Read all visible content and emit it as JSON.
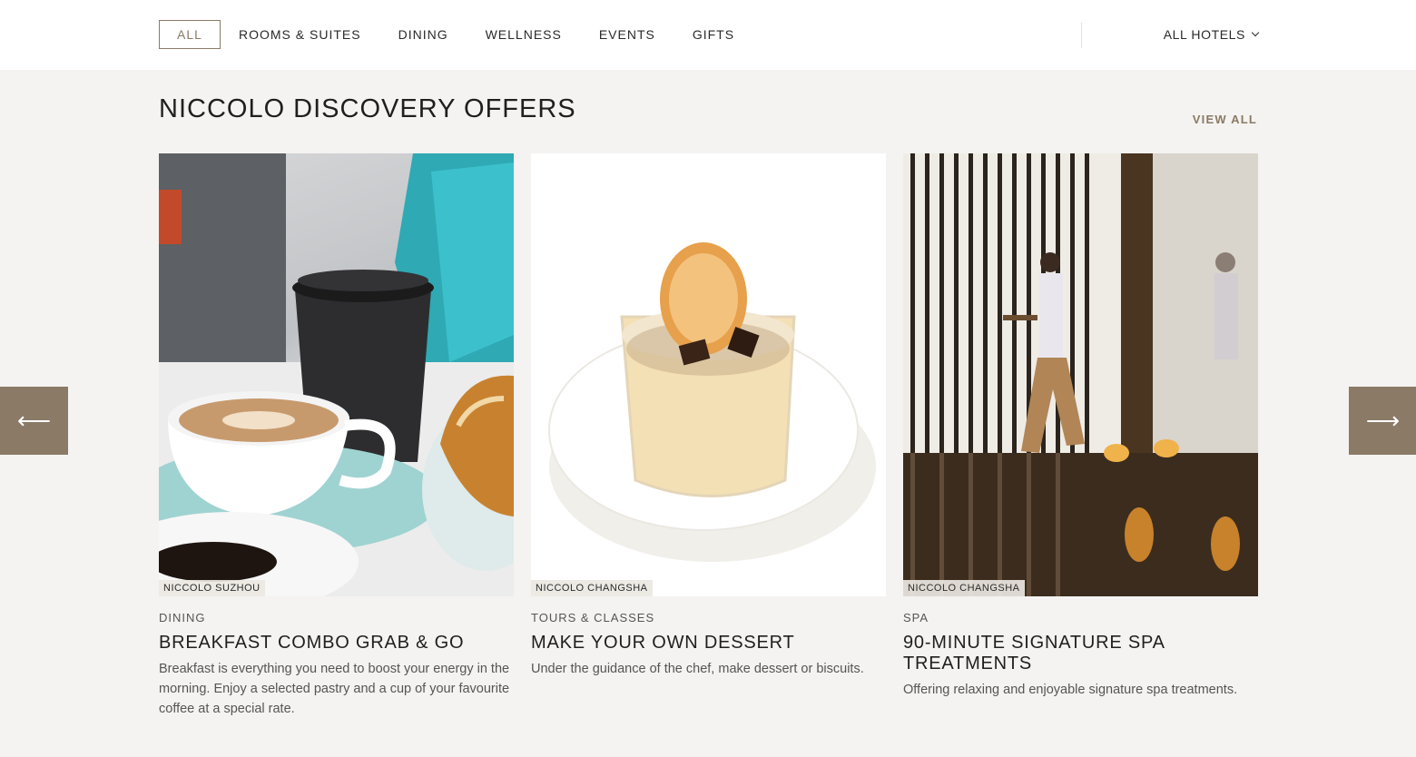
{
  "nav": {
    "tabs": [
      {
        "label": "ALL",
        "active": true
      },
      {
        "label": "ROOMS & SUITES",
        "active": false
      },
      {
        "label": "DINING",
        "active": false
      },
      {
        "label": "WELLNESS",
        "active": false
      },
      {
        "label": "EVENTS",
        "active": false
      },
      {
        "label": "GIFTS",
        "active": false
      }
    ],
    "hotel_filter": "ALL HOTELS",
    "hotel_filter_icon": "chevron-down-icon"
  },
  "section": {
    "title": "NICCOLO DISCOVERY OFFERS",
    "view_all": "VIEW ALL"
  },
  "carousel": {
    "prev_icon": "arrow-left-icon",
    "prev_glyph": "⟵",
    "next_icon": "arrow-right-icon",
    "next_glyph": "⟶"
  },
  "cards": [
    {
      "tag": "NICCOLO SUZHOU",
      "category": "DINING",
      "title": "BREAKFAST COMBO GRAB & GO",
      "description": "Breakfast is everything you need to boost your energy in the morning. Enjoy a selected pastry and a cup of your favourite coffee at a special rate."
    },
    {
      "tag": "NICCOLO CHANGSHA",
      "category": "TOURS & CLASSES",
      "title": "MAKE YOUR OWN DESSERT",
      "description": "Under the guidance of the chef, make dessert or biscuits."
    },
    {
      "tag": "NICCOLO CHANGSHA",
      "category": "SPA",
      "title": "90-MINUTE SIGNATURE SPA TREATMENTS",
      "description": "Offering relaxing and enjoyable signature spa treatments."
    }
  ],
  "colors": {
    "accent": "#8a7a66",
    "background": "#f4f3f1",
    "header": "#ffffff"
  }
}
